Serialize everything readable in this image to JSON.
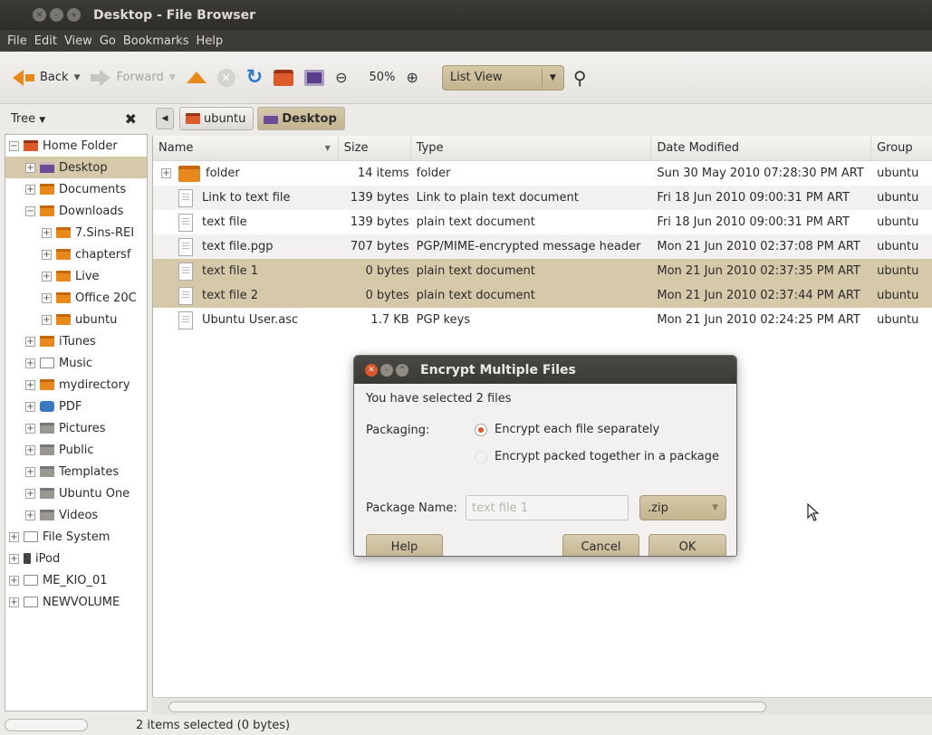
{
  "window": {
    "title": "Desktop - File Browser"
  },
  "menubar": [
    "File",
    "Edit",
    "View",
    "Go",
    "Bookmarks",
    "Help"
  ],
  "toolbar": {
    "back_label": "Back",
    "forward_label": "Forward",
    "zoom_level": "50%",
    "view_mode": "List View"
  },
  "sidebar": {
    "header_label": "Tree",
    "items": [
      {
        "label": "Home Folder",
        "icon": "home-folder-icon",
        "expander": "−",
        "indent": 0
      },
      {
        "label": "Desktop",
        "icon": "desktop-icon",
        "expander": "+",
        "indent": 1,
        "selected": true
      },
      {
        "label": "Documents",
        "icon": "folder-icon",
        "expander": "+",
        "indent": 1
      },
      {
        "label": "Downloads",
        "icon": "folder-icon",
        "expander": "−",
        "indent": 1
      },
      {
        "label": "7.Sins-REI",
        "icon": "folder-icon",
        "expander": "+",
        "indent": 2
      },
      {
        "label": "chaptersf",
        "icon": "folder-icon",
        "expander": "+",
        "indent": 2
      },
      {
        "label": "Live",
        "icon": "folder-icon",
        "expander": "+",
        "indent": 2
      },
      {
        "label": "Office 20C",
        "icon": "folder-icon",
        "expander": "+",
        "indent": 2
      },
      {
        "label": "ubuntu",
        "icon": "folder-icon",
        "expander": "+",
        "indent": 2
      },
      {
        "label": "iTunes",
        "icon": "folder-icon",
        "expander": "+",
        "indent": 1
      },
      {
        "label": "Music",
        "icon": "music-icon",
        "expander": "+",
        "indent": 1
      },
      {
        "label": "mydirectory",
        "icon": "folder-icon",
        "expander": "+",
        "indent": 1
      },
      {
        "label": "PDF",
        "icon": "pdf-icon",
        "expander": "+",
        "indent": 1
      },
      {
        "label": "Pictures",
        "icon": "pictures-icon",
        "expander": "+",
        "indent": 1
      },
      {
        "label": "Public",
        "icon": "public-icon",
        "expander": "+",
        "indent": 1
      },
      {
        "label": "Templates",
        "icon": "templates-icon",
        "expander": "+",
        "indent": 1
      },
      {
        "label": "Ubuntu One",
        "icon": "ubuntu-one-icon",
        "expander": "+",
        "indent": 1
      },
      {
        "label": "Videos",
        "icon": "videos-icon",
        "expander": "+",
        "indent": 1
      },
      {
        "label": "File System",
        "icon": "drive-icon",
        "expander": "+",
        "indent": 0
      },
      {
        "label": "iPod",
        "icon": "ipod-icon",
        "expander": "+",
        "indent": 0
      },
      {
        "label": "ME_KIO_01",
        "icon": "drive-icon",
        "expander": "+",
        "indent": 0
      },
      {
        "label": "NEWVOLUME",
        "icon": "drive-icon",
        "expander": "+",
        "indent": 0
      }
    ]
  },
  "pathbar": {
    "crumbs": [
      "ubuntu",
      "Desktop"
    ]
  },
  "filelist": {
    "columns": [
      "Name",
      "Size",
      "Type",
      "Date Modified",
      "Group"
    ],
    "rows": [
      {
        "name": "folder",
        "size": "14 items",
        "type": "folder",
        "date": "Sun 30 May 2010 07:28:30 PM ART",
        "group": "ubuntu",
        "kind": "folder"
      },
      {
        "name": "Link to text file",
        "size": "139 bytes",
        "type": "Link to plain text document",
        "date": "Fri 18 Jun 2010 09:00:31 PM ART",
        "group": "ubuntu",
        "kind": "doc"
      },
      {
        "name": "text file",
        "size": "139 bytes",
        "type": "plain text document",
        "date": "Fri 18 Jun 2010 09:00:31 PM ART",
        "group": "ubuntu",
        "kind": "doc"
      },
      {
        "name": "text file.pgp",
        "size": "707 bytes",
        "type": "PGP/MIME-encrypted message header",
        "date": "Mon 21 Jun 2010 02:37:08 PM ART",
        "group": "ubuntu",
        "kind": "doc"
      },
      {
        "name": "text file 1",
        "size": "0 bytes",
        "type": "plain text document",
        "date": "Mon 21 Jun 2010 02:37:35 PM ART",
        "group": "ubuntu",
        "kind": "doc",
        "selected": true
      },
      {
        "name": "text file 2",
        "size": "0 bytes",
        "type": "plain text document",
        "date": "Mon 21 Jun 2010 02:37:44 PM ART",
        "group": "ubuntu",
        "kind": "doc",
        "selected": true
      },
      {
        "name": "Ubuntu User.asc",
        "size": "1.7 KB",
        "type": "PGP keys",
        "date": "Mon 21 Jun 2010 02:24:25 PM ART",
        "group": "ubuntu",
        "kind": "doc"
      }
    ]
  },
  "dialog": {
    "title": "Encrypt Multiple Files",
    "selected_text": "You have selected 2 files",
    "packaging_label": "Packaging:",
    "option_separate": "Encrypt each file separately",
    "option_package": "Encrypt packed together in a package",
    "package_name_label": "Package Name:",
    "package_name_value": "text file 1",
    "extension": ".zip",
    "help_label": "Help",
    "cancel_label": "Cancel",
    "ok_label": "OK"
  },
  "status": {
    "text": "2 items selected (0 bytes)"
  },
  "colors": {
    "selection": "#d6c9a9",
    "accent": "#e88a1b",
    "titlebar": "#3c3b37"
  }
}
